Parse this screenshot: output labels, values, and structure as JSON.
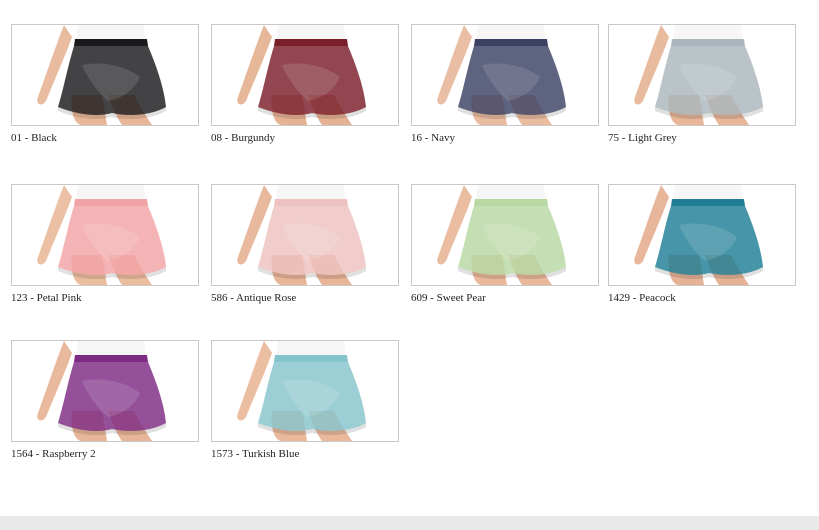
{
  "swatches": [
    {
      "label": "01 - Black",
      "color": "#1a1a1c"
    },
    {
      "label": "08 - Burgundy",
      "color": "#7a1e2a"
    },
    {
      "label": "16 - Navy",
      "color": "#3a4163"
    },
    {
      "label": "75 - Light Grey",
      "color": "#aab6bc"
    },
    {
      "label": "123 - Petal Pink",
      "color": "#f2a3a6"
    },
    {
      "label": "586 - Antique Rose",
      "color": "#edc2c0"
    },
    {
      "label": "609 - Sweet Pear",
      "color": "#b7d8a3"
    },
    {
      "label": "1429 - Peacock",
      "color": "#1e7e95"
    },
    {
      "label": "1564 - Raspberry 2",
      "color": "#7d2b84"
    },
    {
      "label": "1573 - Turkish Blue",
      "color": "#86c4cc"
    }
  ]
}
